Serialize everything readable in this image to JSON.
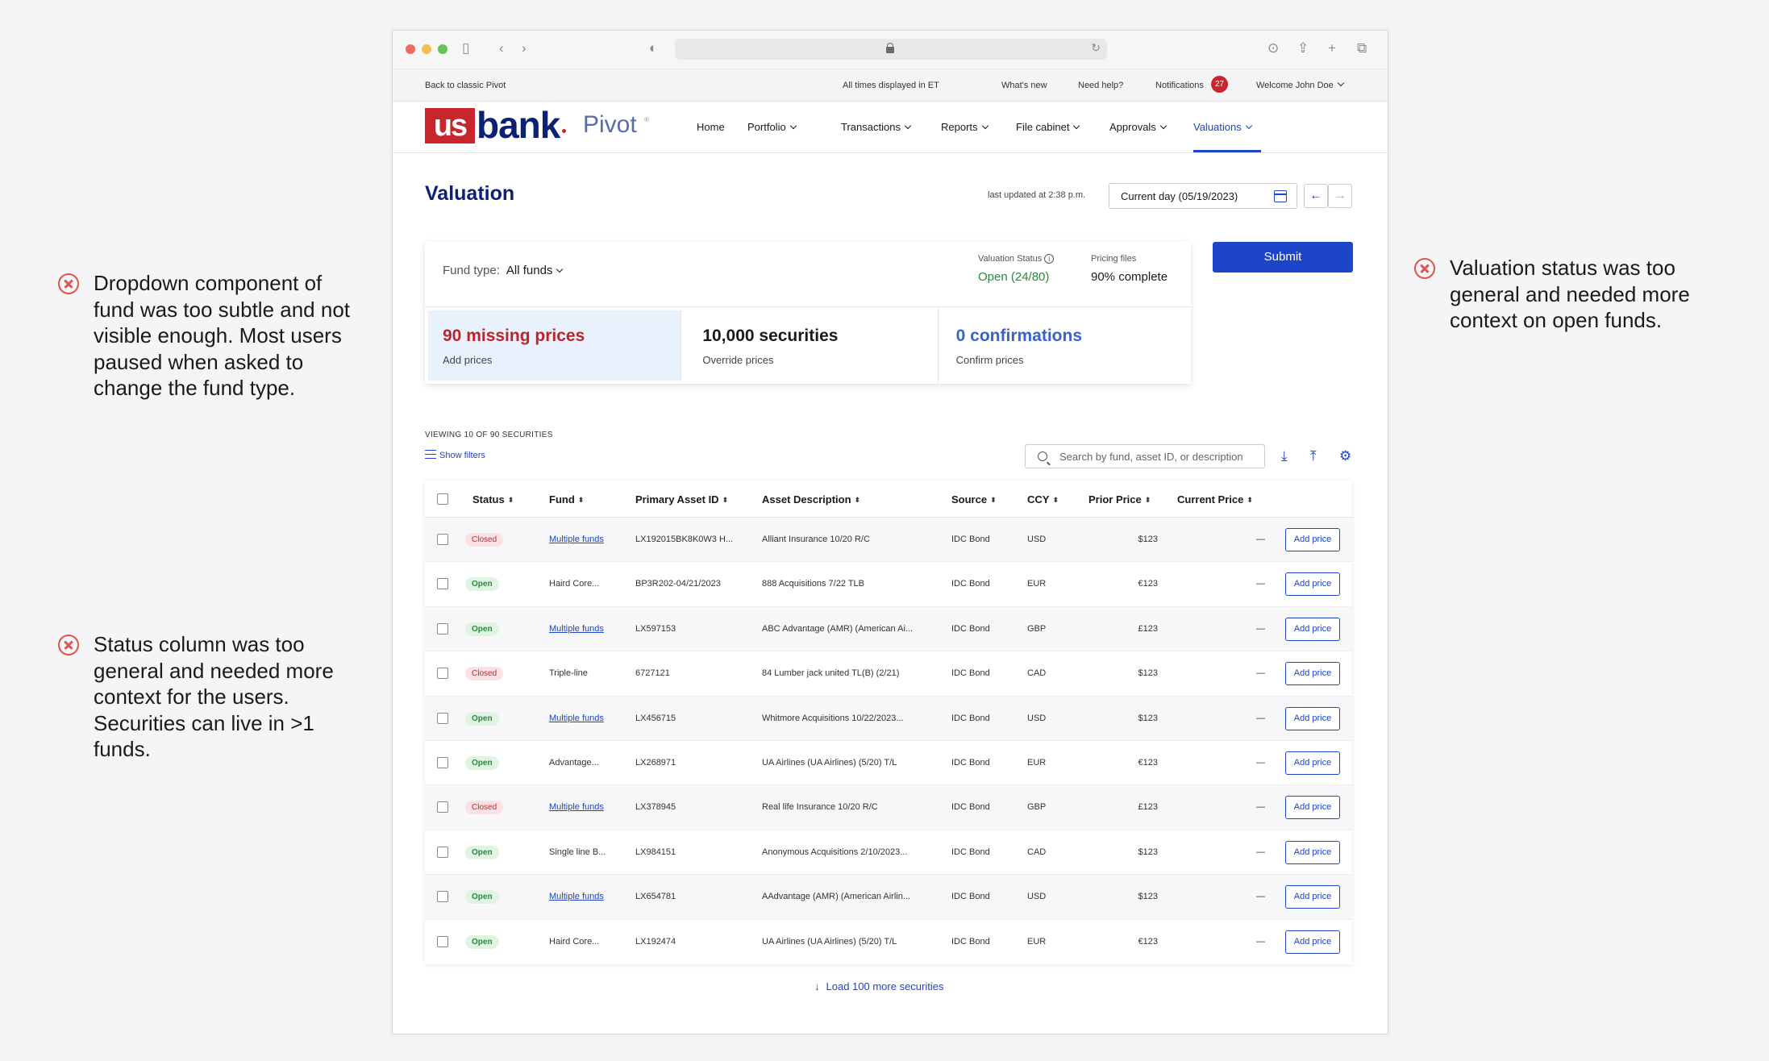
{
  "annotations": [
    {
      "text": "Dropdown component of fund was too subtle and not visible enough. Most users paused when asked to change the fund type."
    },
    {
      "text": "Status column was too general and needed more context for the users. Securities can live in >1 funds."
    },
    {
      "text": "Valuation status was too general and needed more context on open funds."
    }
  ],
  "utility_bar": {
    "back": "Back to classic Pivot",
    "timezone": "All times displayed in ET",
    "whats_new": "What's new",
    "help": "Need help?",
    "notifications": "Notifications",
    "notification_count": "27",
    "welcome": "Welcome John Doe"
  },
  "logo": {
    "us": "us",
    "bank": "bank",
    "pivot": "Pivot",
    "reg": "®"
  },
  "nav": {
    "items": [
      "Home",
      "Portfolio",
      "Transactions",
      "Reports",
      "File cabinet",
      "Approvals",
      "Valuations"
    ],
    "active": "Valuations"
  },
  "page": {
    "title": "Valuation",
    "last_updated": "last updated at 2:38 p.m.",
    "date": "Current day (05/19/2023)",
    "prev_icon": "←",
    "next_icon": "→"
  },
  "summary": {
    "fund_type_label": "Fund type:",
    "fund_type_value": "All funds",
    "valuation_status_label": "Valuation Status",
    "valuation_status_value": "Open (24/80)",
    "pricing_files_label": "Pricing files",
    "pricing_files_value": "90% complete",
    "tiles": [
      {
        "big": "90 missing prices",
        "small": "Add prices",
        "color": "#b8252c"
      },
      {
        "big": "10,000 securities",
        "small": "Override prices",
        "color": "#1a1a1a"
      },
      {
        "big": "0 confirmations",
        "small": "Confirm prices",
        "color": "#3a62c8"
      }
    ],
    "submit": "Submit"
  },
  "table_controls": {
    "viewing": "VIEWING 10 OF 90 SECURITIES",
    "show_filters": "Show filters",
    "search_placeholder": "Search by fund, asset ID, or description"
  },
  "table": {
    "columns": [
      "Status",
      "Fund",
      "Primary Asset ID",
      "Asset Description",
      "Source",
      "CCY",
      "Prior Price",
      "Current Price"
    ],
    "rows": [
      {
        "status": "Closed",
        "fund": "Multiple funds",
        "asset_id": "LX192015BK8K0W3 H...",
        "desc": "Alliant Insurance 10/20 R/C",
        "source": "IDC Bond",
        "ccy": "USD",
        "prior": "$123",
        "current": "—",
        "action": "Add price"
      },
      {
        "status": "Open",
        "fund": "Haird Core...",
        "asset_id": "BP3R202-04/21/2023",
        "desc": "888 Acquisitions 7/22 TLB",
        "source": "IDC Bond",
        "ccy": "EUR",
        "prior": "€123",
        "current": "—",
        "action": "Add price"
      },
      {
        "status": "Open",
        "fund": "Multiple funds",
        "asset_id": "LX597153",
        "desc": "ABC Advantage (AMR) (American Ai...",
        "source": "IDC Bond",
        "ccy": "GBP",
        "prior": "£123",
        "current": "—",
        "action": "Add price"
      },
      {
        "status": "Closed",
        "fund": "Triple-line",
        "asset_id": "6727121",
        "desc": "84 Lumber jack united TL(B) (2/21)",
        "source": "IDC Bond",
        "ccy": "CAD",
        "prior": "$123",
        "current": "—",
        "action": "Add price"
      },
      {
        "status": "Open",
        "fund": "Multiple funds",
        "asset_id": "LX456715",
        "desc": "Whitmore Acquisitions 10/22/2023...",
        "source": "IDC Bond",
        "ccy": "USD",
        "prior": "$123",
        "current": "—",
        "action": "Add price"
      },
      {
        "status": "Open",
        "fund": "Advantage...",
        "asset_id": "LX268971",
        "desc": "UA Airlines (UA Airlines) (5/20) T/L",
        "source": "IDC Bond",
        "ccy": "EUR",
        "prior": "€123",
        "current": "—",
        "action": "Add price"
      },
      {
        "status": "Closed",
        "fund": "Multiple funds",
        "asset_id": "LX378945",
        "desc": "Real life Insurance 10/20 R/C",
        "source": "IDC Bond",
        "ccy": "GBP",
        "prior": "£123",
        "current": "—",
        "action": "Add price"
      },
      {
        "status": "Open",
        "fund": "Single line B...",
        "asset_id": "LX984151",
        "desc": "Anonymous Acquisitions 2/10/2023...",
        "source": "IDC Bond",
        "ccy": "CAD",
        "prior": "$123",
        "current": "—",
        "action": "Add price"
      },
      {
        "status": "Open",
        "fund": "Multiple funds",
        "asset_id": "LX654781",
        "desc": "AAdvantage (AMR) (American Airlin...",
        "source": "IDC Bond",
        "ccy": "USD",
        "prior": "$123",
        "current": "—",
        "action": "Add price"
      },
      {
        "status": "Open",
        "fund": "Haird Core...",
        "asset_id": "LX192474",
        "desc": "UA Airlines (UA Airlines) (5/20) T/L",
        "source": "IDC Bond",
        "ccy": "EUR",
        "prior": "€123",
        "current": "—",
        "action": "Add price"
      }
    ]
  },
  "load_more": "Load 100 more securities",
  "colors": {
    "brand_navy": "#0c2074",
    "brand_red": "#c8262d",
    "accent_blue": "#1e44c8",
    "open_green": "#2a8a3c",
    "annotation_red": "#d9574f"
  }
}
